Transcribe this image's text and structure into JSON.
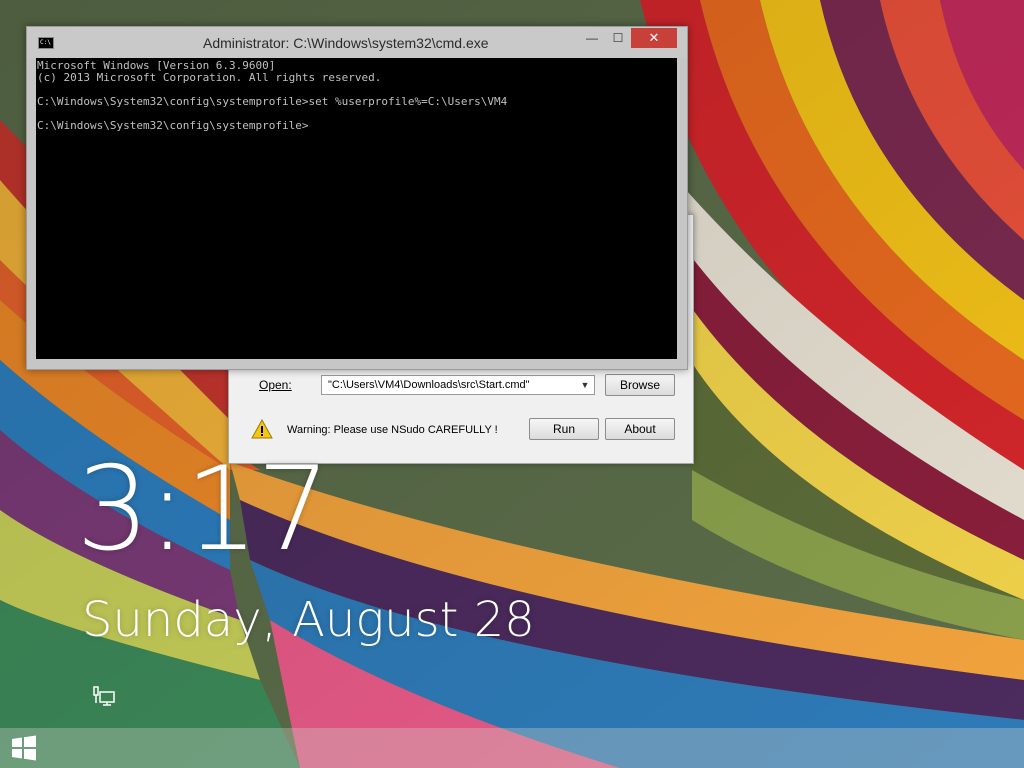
{
  "cmd": {
    "title": "Administrator: C:\\Windows\\system32\\cmd.exe",
    "icon_label": "C:\\",
    "controls": {
      "minimize": "—",
      "maximize": "☐",
      "close": "✕"
    },
    "lines": [
      "Microsoft Windows [Version 6.3.9600]",
      "(c) 2013 Microsoft Corporation. All rights reserved.",
      "",
      "C:\\Windows\\System32\\config\\systemprofile>set %userprofile%=C:\\Users\\VM4",
      "",
      "C:\\Windows\\System32\\config\\systemprofile>"
    ]
  },
  "nsudo": {
    "open_label": "Open:",
    "open_value": "\"C:\\Users\\VM4\\Downloads\\src\\Start.cmd\"",
    "browse_label": "Browse",
    "warning_text": "Warning: Please use NSudo CAREFULLY !",
    "run_label": "Run",
    "about_label": "About"
  },
  "lockscreen": {
    "time": "3:17",
    "date": "Sunday, August 28"
  },
  "icons": {
    "network": "network-icon",
    "start": "windows-start-icon",
    "warning": "warning-icon",
    "cmd": "cmd-icon"
  }
}
